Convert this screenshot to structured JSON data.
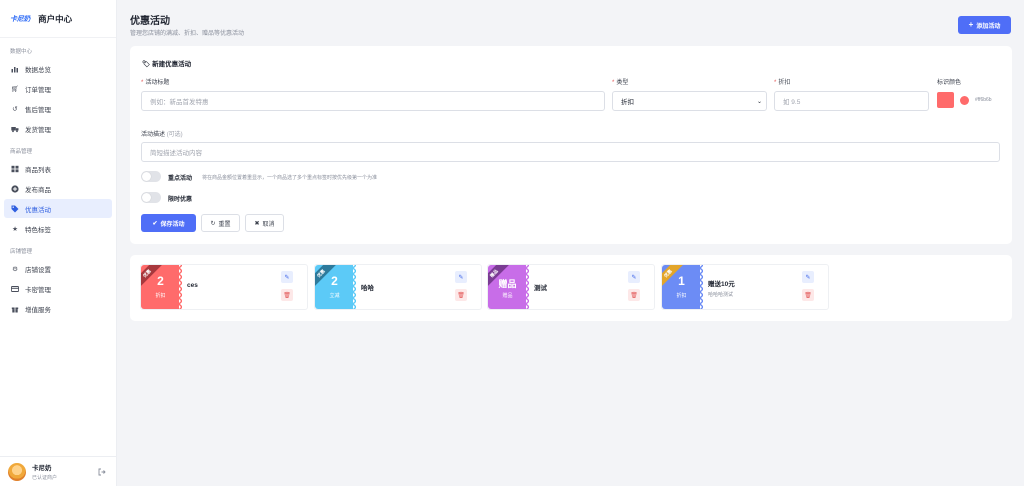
{
  "brand": {
    "logo": "卡尼奶",
    "title": "商户中心"
  },
  "sidebar": {
    "groups": [
      {
        "label": "数据中心",
        "items": [
          {
            "label": "数据总览",
            "icon": "bar-chart-icon"
          },
          {
            "label": "订单管理",
            "icon": "cart-icon"
          },
          {
            "label": "售后管理",
            "icon": "undo-icon"
          },
          {
            "label": "发货管理",
            "icon": "truck-icon"
          }
        ]
      },
      {
        "label": "商品管理",
        "items": [
          {
            "label": "商品列表",
            "icon": "grid-icon"
          },
          {
            "label": "发布商品",
            "icon": "plus-circle-icon"
          },
          {
            "label": "优惠活动",
            "icon": "tag-icon",
            "active": true
          },
          {
            "label": "特色标签",
            "icon": "star-icon"
          }
        ]
      },
      {
        "label": "店铺管理",
        "items": [
          {
            "label": "店铺设置",
            "icon": "gear-icon"
          },
          {
            "label": "卡密管理",
            "icon": "card-icon"
          },
          {
            "label": "增值服务",
            "icon": "gift-icon"
          }
        ]
      }
    ]
  },
  "user": {
    "name": "卡尼奶",
    "status": "已认证商户"
  },
  "header": {
    "title": "优惠活动",
    "subtitle": "管理您店铺的满减、折扣、赠品等优惠活动",
    "add_label": "添加活动"
  },
  "form": {
    "heading": "新建优惠活动",
    "title_label": "活动标题",
    "title_placeholder": "例如：新品首发特惠",
    "type_label": "类型",
    "type_value": "折扣",
    "discount_label": "折扣",
    "discount_placeholder": "如 9.5",
    "color_label": "标识颜色",
    "color_value": "#ff6b6b",
    "color_hex_text": "#ff6b6b",
    "desc_label": "活动描述",
    "desc_optional": "(可选)",
    "desc_placeholder": "简短描述活动内容",
    "featured_label": "重点活动",
    "featured_hint": "将在商品金额位置着重显示，一个商品选了多个重点标签时按优先级第一个为准",
    "limited_label": "限时优惠",
    "save_label": "保存活动",
    "reset_label": "重置",
    "cancel_label": "取消"
  },
  "promotions": [
    {
      "ribbon": "优惠",
      "num": "2",
      "type": "折扣",
      "name": "ces",
      "desc": "",
      "color": "#ff6b6b",
      "ribbon_color": "#a8383d"
    },
    {
      "ribbon": "优惠",
      "num": "2",
      "type": "立减",
      "name": "哈哈",
      "desc": "",
      "color": "#5ccaf7",
      "ribbon_color": "#2d7a9c"
    },
    {
      "ribbon": "赠品",
      "num": "赠品",
      "type": "赠品",
      "name": "测试",
      "desc": "",
      "color": "#c86de8",
      "ribbon_color": "#7a3b93"
    },
    {
      "ribbon": "优惠",
      "num": "1",
      "type": "折扣",
      "name": "赠送10元",
      "desc": "哈哈哈测试",
      "color": "#6c8cf5",
      "ribbon_color": "#e3a52a"
    }
  ]
}
